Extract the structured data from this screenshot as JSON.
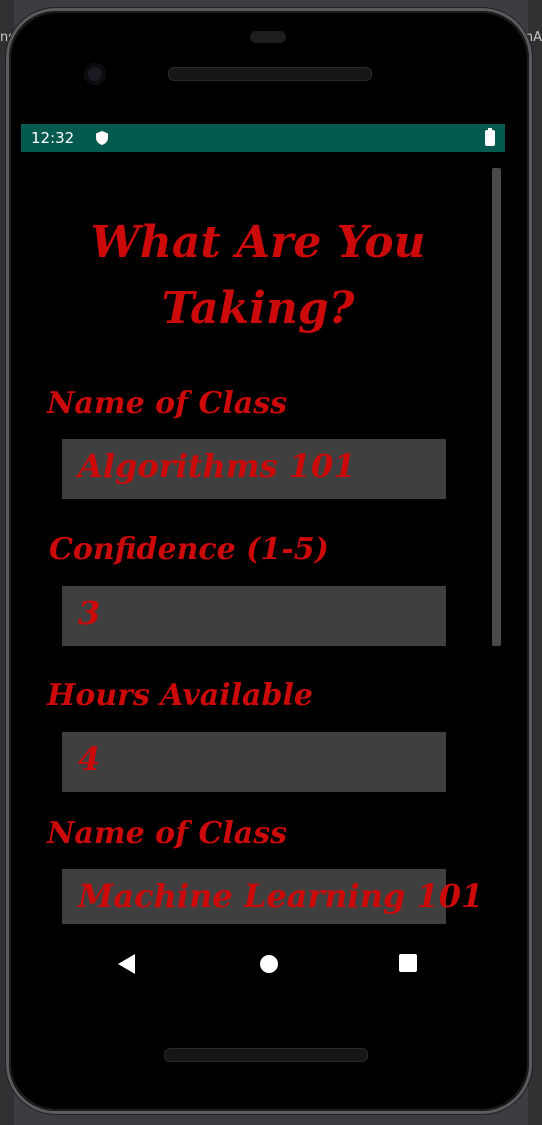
{
  "ide_edge": {
    "left_text": "ns",
    "right_text": "nA"
  },
  "statusbar": {
    "time": "12:32",
    "icons": [
      "shield-icon",
      "battery-icon"
    ],
    "color": "#055a50"
  },
  "app": {
    "title": "What Are You Taking?",
    "accent_color": "#cc0a0a",
    "fields": [
      {
        "label": "Name of Class",
        "value": "Algorithms 101"
      },
      {
        "label": "Confidence (1-5)",
        "value": "3"
      },
      {
        "label": "Hours Available",
        "value": "4"
      },
      {
        "label": "Name of Class",
        "value": "Machine Learning 101"
      }
    ]
  },
  "navbar": {
    "buttons": [
      "back-icon",
      "home-icon",
      "recents-icon"
    ]
  }
}
